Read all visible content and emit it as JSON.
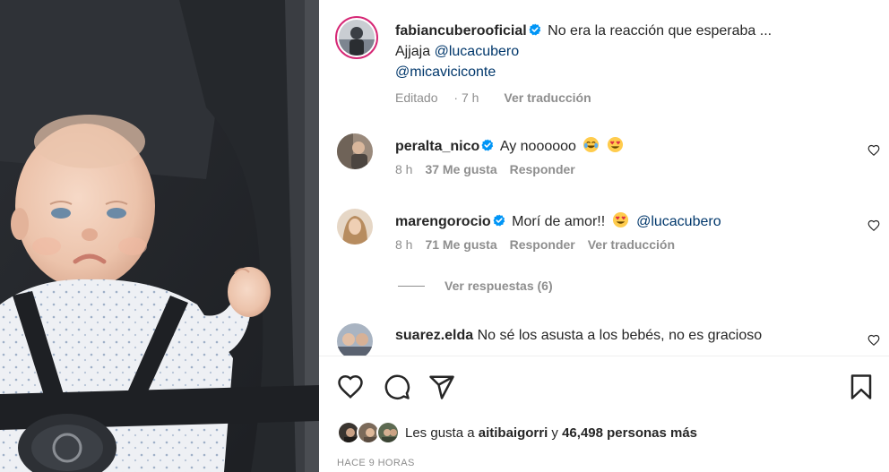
{
  "post": {
    "author": "fabiancuberooficial",
    "caption_line1": "No era la reacción que esperaba ...",
    "caption_prefix": "Ajjaja",
    "mention1": "@lucacubero",
    "mention2": "@micaviciconte",
    "edited": "Editado",
    "age": "7 h",
    "translate": "Ver traducción"
  },
  "comments": [
    {
      "username": "peralta_nico",
      "text": "Ay noooooo",
      "emojis": [
        "joy-emoji",
        "heart-eyes-emoji"
      ],
      "age": "8 h",
      "likes": "37 Me gusta",
      "reply": "Responder"
    },
    {
      "username": "marengorocio",
      "text": "Morí de amor!!",
      "emojis": [
        "heart-eyes-emoji"
      ],
      "mention": "@lucacubero",
      "age": "8 h",
      "likes": "71 Me gusta",
      "reply": "Responder",
      "translate": "Ver traducción"
    },
    {
      "username": "suarez.elda",
      "text": "No sé los asusta a los bebés, no es gracioso"
    }
  ],
  "view_replies": "Ver respuestas (6)",
  "actions": {
    "like_icon": "heart-outline-icon",
    "comment_icon": "comment-bubble-icon",
    "share_icon": "paper-plane-icon",
    "save_icon": "bookmark-icon"
  },
  "likes": {
    "prefix": "Les gusta a",
    "user": "aitibaigorri",
    "joiner": "y",
    "count": "46,498 personas más"
  },
  "time_ago": "HACE 9 HORAS",
  "colors": {
    "text": "#262626",
    "secondary": "#8e8e8e",
    "mention": "#00376b",
    "verified": "#0095f6"
  }
}
